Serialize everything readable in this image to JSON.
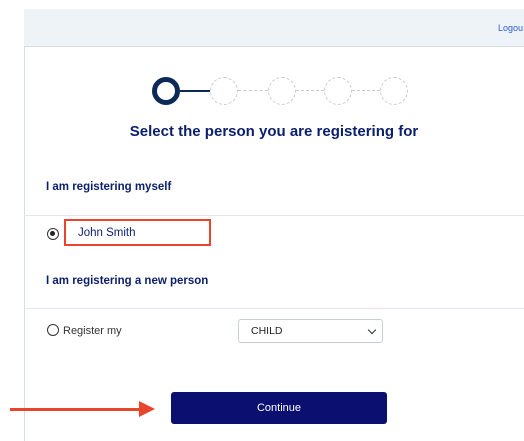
{
  "header": {
    "logout_label": "Logou"
  },
  "stepper": {
    "total_steps": 5,
    "current_step": 1
  },
  "page": {
    "title": "Select the person you are registering for"
  },
  "self_section": {
    "heading": "I am registering myself",
    "person_name": "John Smith",
    "selected": true
  },
  "new_person_section": {
    "heading": "I am registering a new person",
    "radio_label": "Register my",
    "relation_select_value": "CHILD",
    "selected": false
  },
  "actions": {
    "continue_label": "Continue"
  },
  "colors": {
    "navy": "#0b1f6b",
    "button": "#0b1070",
    "annotation": "#e8452c"
  }
}
